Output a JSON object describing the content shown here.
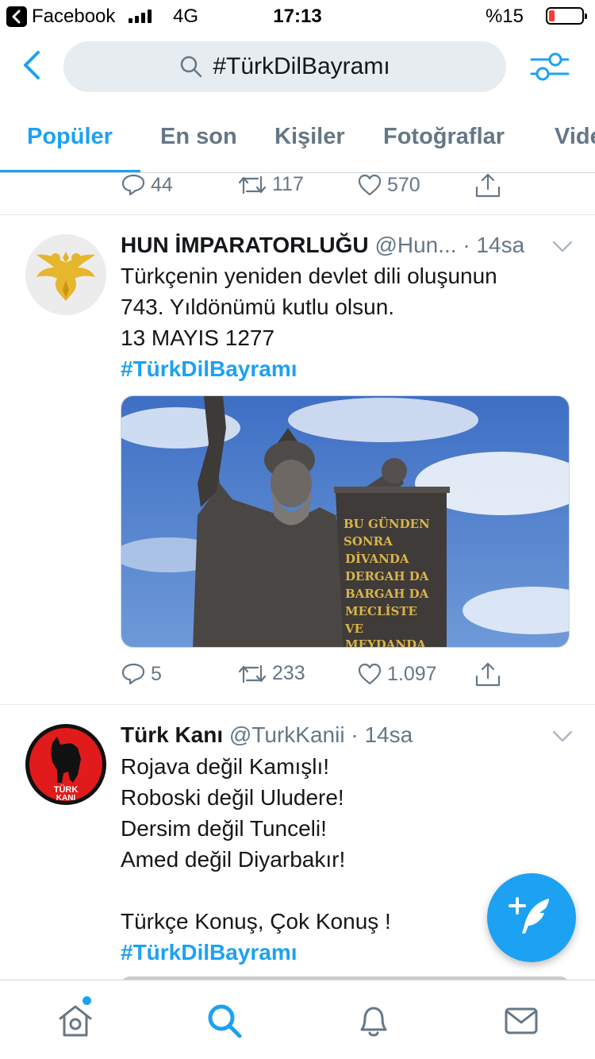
{
  "status_bar": {
    "back_app": "Facebook",
    "network": "4G",
    "time": "17:13",
    "battery": "%15"
  },
  "search": {
    "query": "#TürkDilBayramı"
  },
  "tabs": [
    {
      "label": "Popüler",
      "active": true
    },
    {
      "label": "En son",
      "active": false
    },
    {
      "label": "Kişiler",
      "active": false
    },
    {
      "label": "Fotoğraflar",
      "active": false
    },
    {
      "label": "Video",
      "active": false
    }
  ],
  "prev_tweet_actions": {
    "replies": "44",
    "retweets": "117",
    "likes": "570"
  },
  "tweets": [
    {
      "name": "HUN İMPARATORLUĞU",
      "handle": "@Hun...",
      "time": "· 14sa",
      "text_lines": [
        "Türkçenin yeniden devlet dili oluşunun",
        "743. Yıldönümü kutlu olsun.",
        "13 MAYIS 1277"
      ],
      "hashtag": "#TürkDilBayramı",
      "media_banner_lines": [
        "BU GÜNDEN",
        "SONRA",
        "DİVANDA",
        "DERGAH DA",
        "BARGAH DA",
        "MECLİSTE",
        "VE",
        "MEYDANDA"
      ],
      "replies": "5",
      "retweets": "233",
      "likes": "1.097"
    },
    {
      "name": "Türk Kanı",
      "handle": "@TurkKanii",
      "time": "· 14sa",
      "avatar_text": [
        "TÜRK",
        "KANI"
      ],
      "text_lines": [
        "Rojava değil Kamışlı!",
        "Roboski değil Uludere!",
        "Dersim değil Tunceli!",
        "Amed değil Diyarbakır!",
        "",
        "Türkçe Konuş, Çok Konuş !"
      ],
      "hashtag": "#TürkDilBayramı"
    }
  ],
  "colors": {
    "accent": "#1da1f2",
    "text": "#14171a",
    "secondary": "#657786",
    "search_bg": "#e6ecf0"
  },
  "icons": {
    "back": "chevron-left-icon",
    "search": "search-icon",
    "filter": "sliders-icon",
    "reply": "reply-icon",
    "retweet": "retweet-icon",
    "like": "heart-icon",
    "share": "share-icon",
    "compose": "compose-icon",
    "home": "home-icon",
    "explore": "search-icon",
    "notifications": "bell-icon",
    "messages": "mail-icon"
  }
}
